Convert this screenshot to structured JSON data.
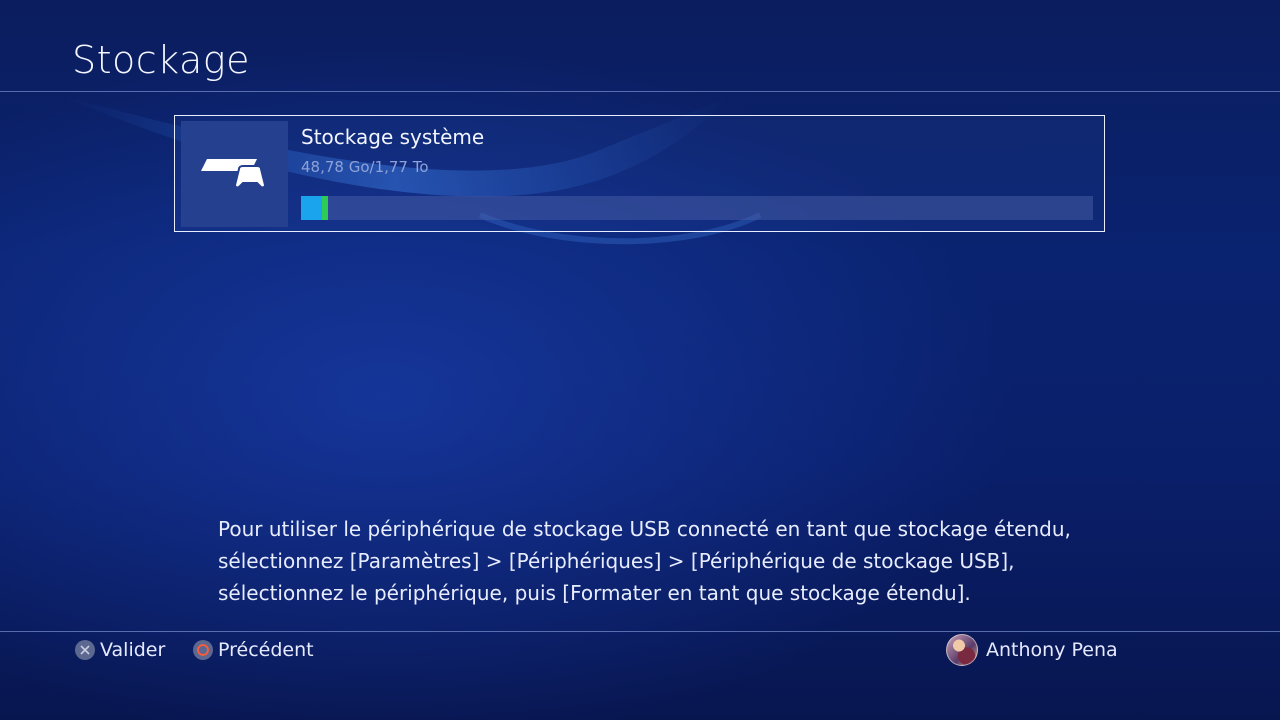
{
  "header": {
    "title": "Stockage"
  },
  "storage": {
    "name": "Stockage système",
    "usage_text": "48,78 Go/1,77 To",
    "used_fraction": 0.0269,
    "colors": {
      "used": "#1aa4ee",
      "secondary": "#2ecb57",
      "track": "#3c4f8f"
    },
    "icon": "ps4-console-controller-icon"
  },
  "help": {
    "lines": [
      "Pour utiliser le périphérique de stockage USB connecté en tant que stockage étendu,",
      "sélectionnez [Paramètres] > [Périphériques] > [Périphérique de stockage USB],",
      "sélectionnez le périphérique, puis [Formater en tant que stockage étendu]."
    ]
  },
  "footer": {
    "confirm": {
      "icon": "cross-button-icon",
      "label": "Valider"
    },
    "back": {
      "icon": "circle-button-icon",
      "label": "Précédent"
    },
    "user": {
      "name": "Anthony Pena"
    }
  }
}
